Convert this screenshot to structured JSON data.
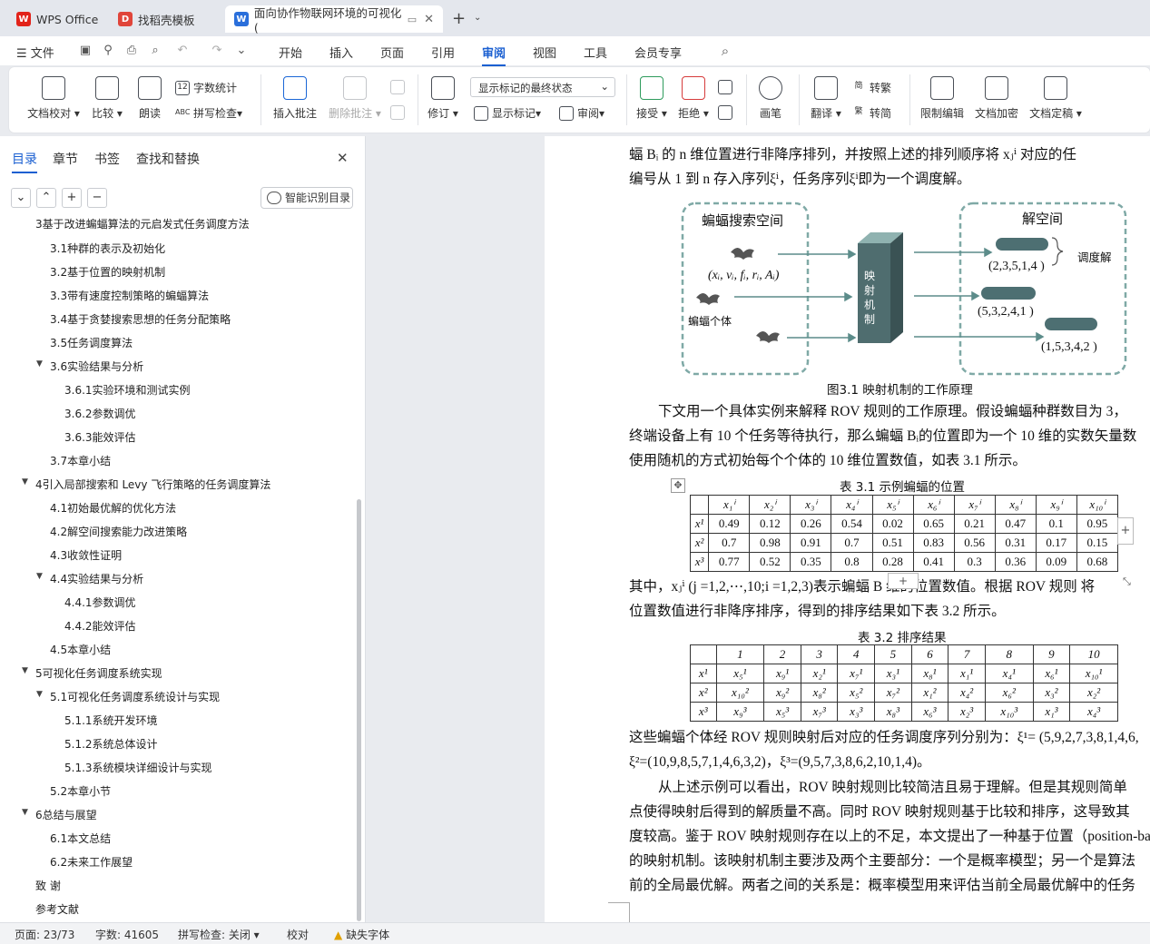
{
  "tabs": [
    {
      "label": "WPS Office",
      "icon": "wps-icon"
    },
    {
      "label": "找稻壳模板",
      "icon": "docer-icon"
    },
    {
      "label": "面向协作物联网环境的可视化(",
      "icon": "word-doc-icon",
      "active": true
    }
  ],
  "menu": {
    "file_label": "文件",
    "items": [
      "开始",
      "插入",
      "页面",
      "引用",
      "审阅",
      "视图",
      "工具",
      "会员专享"
    ],
    "active": "审阅"
  },
  "ribbon": {
    "doc_check": "文档校对",
    "compare": "比较",
    "read_aloud": "朗读",
    "word_count": "字数统计",
    "spell_check": "拼写检查",
    "insert_comment": "插入批注",
    "delete_comment": "删除批注",
    "revise": "修订",
    "markup_select": "显示标记的最终状态",
    "show_markup": "显示标记",
    "review": "审阅",
    "accept": "接受",
    "reject": "拒绝",
    "pen": "画笔",
    "translate": "翻译",
    "to_traditional": "转繁",
    "to_simplified": "转简",
    "restrict_edit": "限制编辑",
    "doc_encrypt": "文档加密",
    "doc_finalize": "文档定稿"
  },
  "sidebar": {
    "tabs": [
      "目录",
      "章节",
      "书签",
      "查找和替换"
    ],
    "active_tab": "目录",
    "smart_toc_button": "智能识别目录",
    "toc": [
      {
        "label": "3基于改进蝙蝠算法的元启发式任务调度方法",
        "level": 1,
        "arrow": false,
        "partial": true
      },
      {
        "label": "3.1种群的表示及初始化",
        "level": 2
      },
      {
        "label": "3.2基于位置的映射机制",
        "level": 2
      },
      {
        "label": "3.3带有速度控制策略的蝙蝠算法",
        "level": 2
      },
      {
        "label": "3.4基于贪婪搜索思想的任务分配策略",
        "level": 2
      },
      {
        "label": "3.5任务调度算法",
        "level": 2
      },
      {
        "label": "3.6实验结果与分析",
        "level": 2,
        "arrow": true
      },
      {
        "label": "3.6.1实验环境和测试实例",
        "level": 3
      },
      {
        "label": "3.6.2参数调优",
        "level": 3
      },
      {
        "label": "3.6.3能效评估",
        "level": 3
      },
      {
        "label": "3.7本章小结",
        "level": 2
      },
      {
        "label": "4引入局部搜索和 Levy 飞行策略的任务调度算法",
        "level": 1,
        "arrow": true
      },
      {
        "label": "4.1初始最优解的优化方法",
        "level": 2
      },
      {
        "label": "4.2解空间搜索能力改进策略",
        "level": 2
      },
      {
        "label": "4.3收敛性证明",
        "level": 2
      },
      {
        "label": "4.4实验结果与分析",
        "level": 2,
        "arrow": true
      },
      {
        "label": "4.4.1参数调优",
        "level": 3
      },
      {
        "label": "4.4.2能效评估",
        "level": 3
      },
      {
        "label": "4.5本章小结",
        "level": 2
      },
      {
        "label": "5可视化任务调度系统实现",
        "level": 1,
        "arrow": true
      },
      {
        "label": "5.1可视化任务调度系统设计与实现",
        "level": 2,
        "arrow": true
      },
      {
        "label": "5.1.1系统开发环境",
        "level": 3
      },
      {
        "label": "5.1.2系统总体设计",
        "level": 3
      },
      {
        "label": "5.1.3系统模块详细设计与实现",
        "level": 3
      },
      {
        "label": "5.2本章小节",
        "level": 2
      },
      {
        "label": "6总结与展望",
        "level": 1,
        "arrow": true
      },
      {
        "label": "6.1本文总结",
        "level": 2
      },
      {
        "label": "6.2未来工作展望",
        "level": 2
      },
      {
        "label": "致      谢",
        "level": 1,
        "arrow": false
      },
      {
        "label": "参考文献",
        "level": 1,
        "arrow": false
      }
    ]
  },
  "document": {
    "lines_top": [
      "蝠 Bᵢ 的 n 维位置进行非降序排列，并按照上述的排列顺序将 xⱼⁱ 对应的任",
      "编号从 1 到 n 存入序列ξⁱ，任务序列ξⁱ即为一个调度解。"
    ],
    "figure": {
      "search_space_title": "蝙蝠搜索空间",
      "solution_space_title": "解空间",
      "individual_tuple": "(xᵢ, vᵢ, fᵢ, rᵢ, Aᵢ)",
      "individual_label": "蝙蝠个体",
      "mapping_label": "映射机制",
      "schedule_label": "调度解",
      "solutions": [
        "(2,3,5,1,4 )",
        "(5,3,2,4,1 )",
        "(1,5,3,4,2 )"
      ],
      "caption": "图3.1 映射机制的工作原理"
    },
    "lines_mid": [
      "下文用一个具体实例来解释 ROV 规则的工作原理。假设蝙蝠种群数目为 3，",
      "终端设备上有 10 个任务等待执行，那么蝙蝠 Bᵢ的位置即为一个 10 维的实数矢量数",
      "使用随机的方式初始每个个体的 10 维位置数值，如表 3.1 所示。"
    ],
    "table1": {
      "caption": "表 3.1  示例蝙蝠的位置",
      "headers": [
        "",
        "x₁ⁱ",
        "x₂ⁱ",
        "x₃ⁱ",
        "x₄ⁱ",
        "x₅ⁱ",
        "x₆ⁱ",
        "x₇ⁱ",
        "x₈ⁱ",
        "x₉ⁱ",
        "x₁₀ⁱ"
      ],
      "rows": [
        [
          "x¹",
          "0.49",
          "0.12",
          "0.26",
          "0.54",
          "0.02",
          "0.65",
          "0.21",
          "0.47",
          "0.1",
          "0.95"
        ],
        [
          "x²",
          "0.7",
          "0.98",
          "0.91",
          "0.7",
          "0.51",
          "0.83",
          "0.56",
          "0.31",
          "0.17",
          "0.15"
        ],
        [
          "x³",
          "0.77",
          "0.52",
          "0.35",
          "0.8",
          "0.28",
          "0.41",
          "0.3",
          "0.36",
          "0.09",
          "0.68"
        ]
      ]
    },
    "lines_after_t1": [
      "其中，xⱼⁱ (j =1,2,⋯,10;i =1,2,3)表示蝙蝠 B     维的位置数值。根据 ROV 规则  将",
      "位置数值进行非降序排序，得到的排序结果如下表 3.2 所示。"
    ],
    "table2": {
      "caption": "表 3.2  排序结果",
      "headers": [
        "",
        "1",
        "2",
        "3",
        "4",
        "5",
        "6",
        "7",
        "8",
        "9",
        "10"
      ],
      "rows": [
        [
          "x¹",
          "x₅¹",
          "x₉¹",
          "x₂¹",
          "x₇¹",
          "x₃¹",
          "x₈¹",
          "x₁¹",
          "x₄¹",
          "x₆¹",
          "x₁₀¹"
        ],
        [
          "x²",
          "x₁₀²",
          "x₉²",
          "x₈²",
          "x₅²",
          "x₇²",
          "x₁²",
          "x₄²",
          "x₆²",
          "x₃²",
          "x₂²"
        ],
        [
          "x³",
          "x₉³",
          "x₅³",
          "x₇³",
          "x₃³",
          "x₈³",
          "x₆³",
          "x₂³",
          "x₁₀³",
          "x₁³",
          "x₄³"
        ]
      ]
    },
    "lines_bottom": [
      "这些蝙蝠个体经 ROV 规则映射后对应的任务调度序列分别为：ξ¹= (5,9,2,7,3,8,1,4,6,",
      "ξ²=(10,9,8,5,7,1,4,6,3,2)，ξ³=(9,5,7,3,8,6,2,10,1,4)。",
      "从上述示例可以看出，ROV 映射规则比较简洁且易于理解。但是其规则简单",
      "点使得映射后得到的解质量不高。同时 ROV 映射规则基于比较和排序，这导致其",
      "度较高。鉴于 ROV 映射规则存在以上的不足，本文提出了一种基于位置（position-ba",
      "的映射机制。该映射机制主要涉及两个主要部分：一个是概率模型；另一个是算法",
      "前的全局最优解。两者之间的关系是：概率模型用来评估当前全局最优解中的任务"
    ]
  },
  "status": {
    "page": "页面: 23/73",
    "words": "字数: 41605",
    "spell": "拼写检查: 关闭",
    "proof": "校对",
    "missing_font": "缺失字体"
  },
  "colors": {
    "accent": "#1a5fd1",
    "dashed_box": "#7fa9a6",
    "mapping_box": "#3f5a5c",
    "wps_red": "#e2231a"
  }
}
